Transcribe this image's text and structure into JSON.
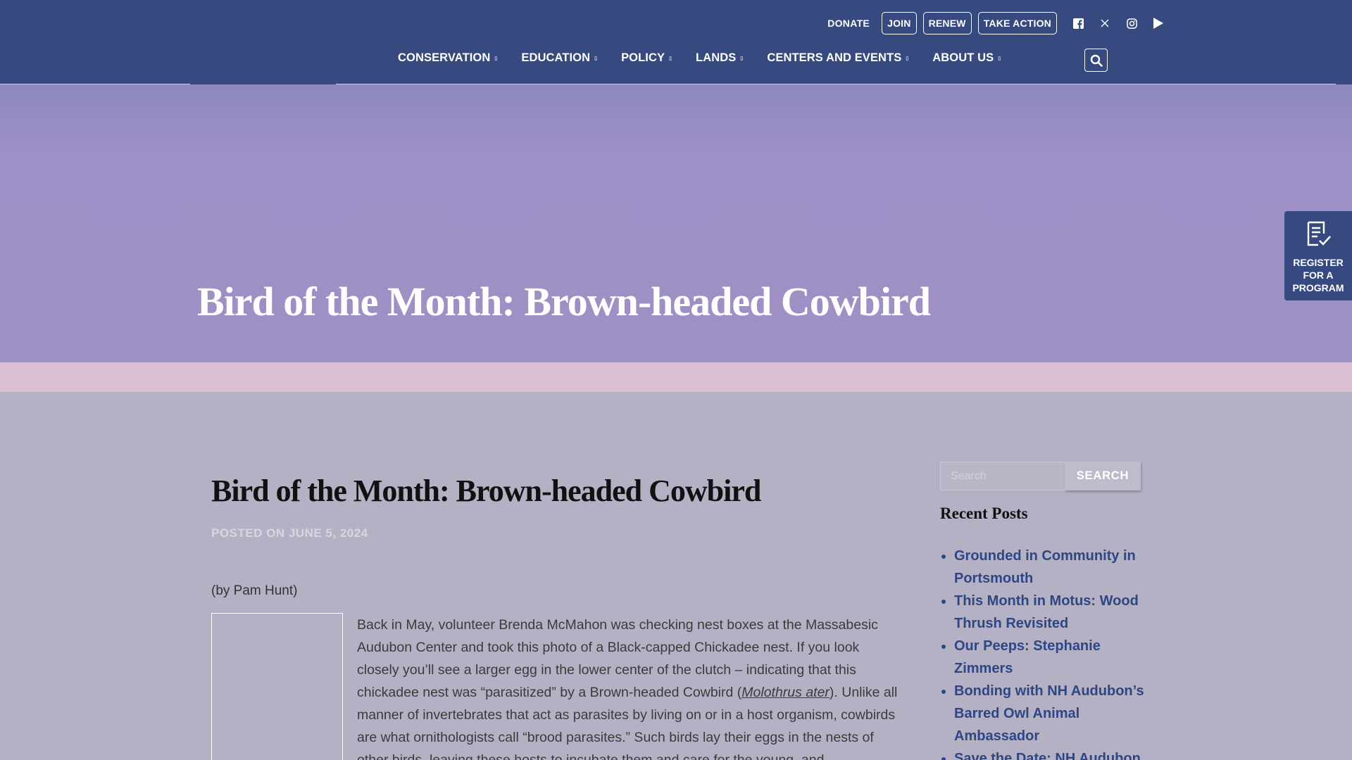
{
  "header": {
    "utility": {
      "donate": "DONATE",
      "join": "JOIN",
      "renew": "RENEW",
      "take_action": "TAKE ACTION"
    },
    "socials": [
      "facebook-icon",
      "x-icon",
      "instagram-icon",
      "youtube-icon"
    ],
    "nav": [
      {
        "label": "CONSERVATION"
      },
      {
        "label": "EDUCATION"
      },
      {
        "label": "POLICY"
      },
      {
        "label": "LANDS"
      },
      {
        "label": "CENTERS AND EVENTS"
      },
      {
        "label": "ABOUT US"
      }
    ]
  },
  "hero": {
    "title": "Bird of the Month: Brown-headed Cowbird"
  },
  "register": {
    "line1": "REGISTER",
    "line2": "FOR A",
    "line3": "PROGRAM"
  },
  "article": {
    "title": "Bird of the Month: Brown-headed Cowbird",
    "posted": "POSTED ON JUNE 5, 2024",
    "byline": "(by Pam Hunt)",
    "body_1": "Back in May, volunteer Brenda McMahon was checking nest boxes at the Massabesic Audubon Center and took this photo of a Black-capped Chickadee nest. If you look closely you’ll see a larger egg in the lower center of the clutch – indicating that this chickadee nest was “parasitized” by a Brown-headed Cowbird (",
    "body_species": "Molothrus ater",
    "body_2": "). Unlike all manner of invertebrates that act as parasites by living on or in a host organism, cowbirds are what ornithologists call “brood parasites.” Such birds lay their eggs in the nests of other birds, leaving these hosts to incubate them and care for the young, and"
  },
  "sidebar": {
    "search_placeholder": "Search",
    "search_button": "SEARCH",
    "recent_title": "Recent Posts",
    "recent_posts": [
      "Grounded in Community in Portsmouth",
      "This Month in Motus: Wood Thrush Revisited",
      "Our Peeps: Stephanie Zimmers",
      "Bonding with NH Audubon’s Barred Owl Animal Ambassador",
      "Save the Date: NH Audubon"
    ]
  },
  "colors": {
    "header_bg": "#364a80",
    "hero_bg": "#9f90c4",
    "pink_band": "#d9c1d1",
    "page_bg": "#b4b1c4",
    "link": "#2f4685"
  }
}
